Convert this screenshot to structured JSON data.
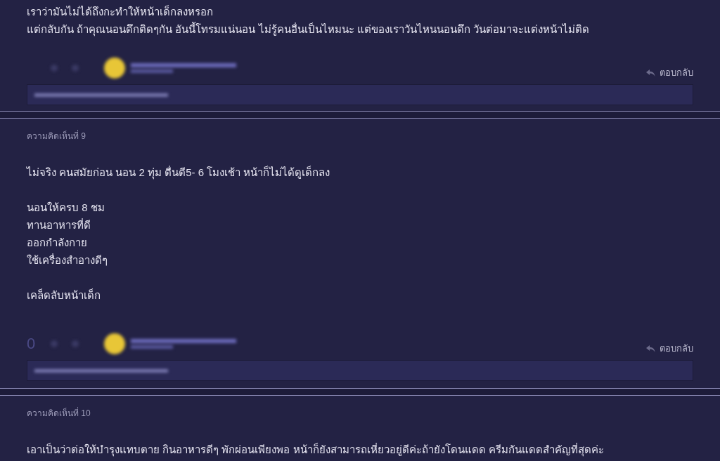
{
  "comments": [
    {
      "paragraphs": [
        [
          "เราว่ามันไม่ได้ถึงกะทำให้หน้าเด็กลงหรอก",
          "แต่กลับกัน ถ้าคุณนอนดึกติดๆกัน อันนี้โทรมแน่นอน ไม่รู้คนอื่นเป็นไหมนะ แต่ของเราวันไหนนอนดึก วันต่อมาจะแต่งหน้าไม่ติด"
        ]
      ],
      "footer": {
        "reply": "ตอบกลับ"
      }
    },
    {
      "label": "ความคิดเห็นที่ 9",
      "paragraphs": [
        [
          "ไม่จริง คนสมัยก่อน นอน 2 ทุ่ม ตื่นตี5- 6 โมงเช้า หน้าก็ไม่ได้ดูเด็กลง"
        ],
        [
          "นอนให้ครบ 8 ชม",
          "ทานอาหารที่ดี",
          "ออกกำลังกาย",
          "ใช้เครื่องสำอางดีๆ"
        ],
        [
          "เคล็ดลับหน้าเด็ก"
        ]
      ],
      "footer": {
        "vote": "0",
        "reply": "ตอบกลับ"
      }
    },
    {
      "label": "ความคิดเห็นที่ 10",
      "paragraphs": [
        [
          "เอาเป็นว่าต่อให้บำรุงแทบตาย กินอาหารดีๆ พักผ่อนเพียงพอ หน้าก็ยังสามารถเหี่ยวอยู่ดีค่ะถ้ายังโดนแดด ครีมกันแดดสำคัญที่สุดค่ะ"
        ]
      ]
    }
  ]
}
